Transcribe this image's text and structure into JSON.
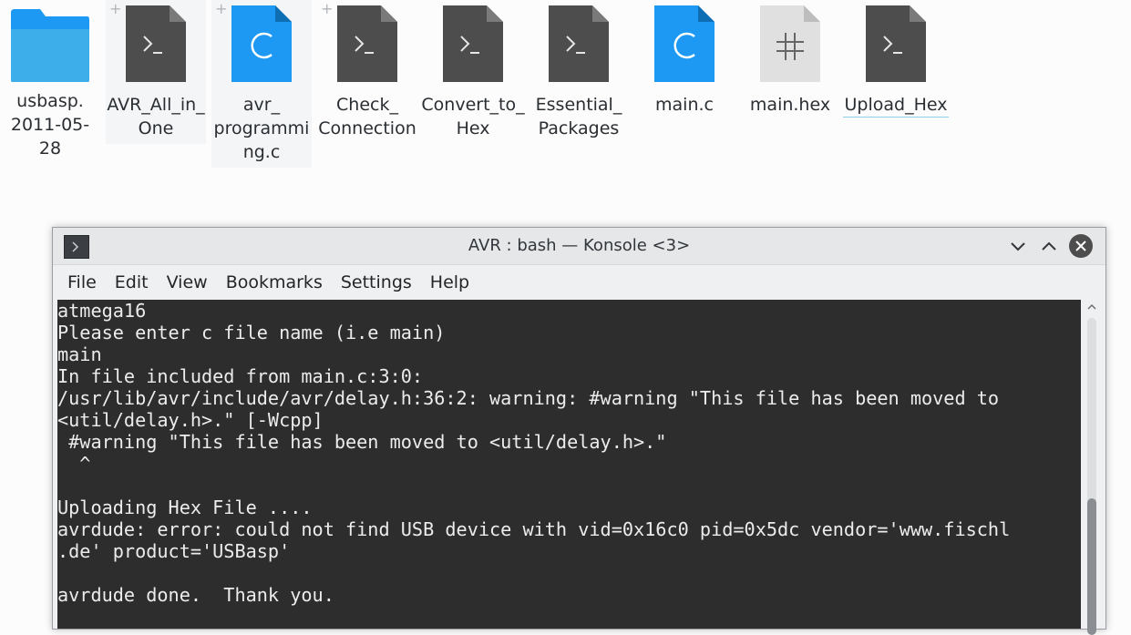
{
  "files": [
    {
      "label": "usbasp.\n2011-05-28",
      "icon": "folder-icon",
      "kind": "folder"
    },
    {
      "label": "AVR_All_in_\nOne",
      "icon": "terminal-script-icon",
      "kind": "script"
    },
    {
      "label": "avr_\nprogrammi\nng.c",
      "icon": "c-source-icon",
      "kind": "csrc"
    },
    {
      "label": "Check_\nConnection",
      "icon": "terminal-script-icon",
      "kind": "script"
    },
    {
      "label": "Convert_to_\nHex",
      "icon": "terminal-script-icon",
      "kind": "script"
    },
    {
      "label": "Essential_\nPackages",
      "icon": "terminal-script-icon",
      "kind": "script"
    },
    {
      "label": "main.c",
      "icon": "c-source-icon",
      "kind": "csrc"
    },
    {
      "label": "main.hex",
      "icon": "hex-file-icon",
      "kind": "hex"
    },
    {
      "label": "Upload_Hex",
      "icon": "terminal-script-icon",
      "kind": "script"
    }
  ],
  "window": {
    "title": "AVR : bash — Konsole <3>",
    "menu": [
      "File",
      "Edit",
      "View",
      "Bookmarks",
      "Settings",
      "Help"
    ]
  },
  "terminal": {
    "lines": [
      "atmega16",
      "Please enter c file name (i.e main)",
      "main",
      "In file included from main.c:3:0:",
      "/usr/lib/avr/include/avr/delay.h:36:2: warning: #warning \"This file has been moved to",
      "<util/delay.h>.\" [-Wcpp]",
      " #warning \"This file has been moved to <util/delay.h>.\"",
      "  ^",
      "",
      "Uploading Hex File ....",
      "avrdude: error: could not find USB device with vid=0x16c0 pid=0x5dc vendor='www.fischl",
      ".de' product='USBasp'",
      "",
      "avrdude done.  Thank you."
    ]
  },
  "colors": {
    "folder_blue": "#1d99f3",
    "script_gray": "#4d4d4d",
    "terminal_bg": "#2d2d2d",
    "terminal_fg": "#ececec"
  }
}
